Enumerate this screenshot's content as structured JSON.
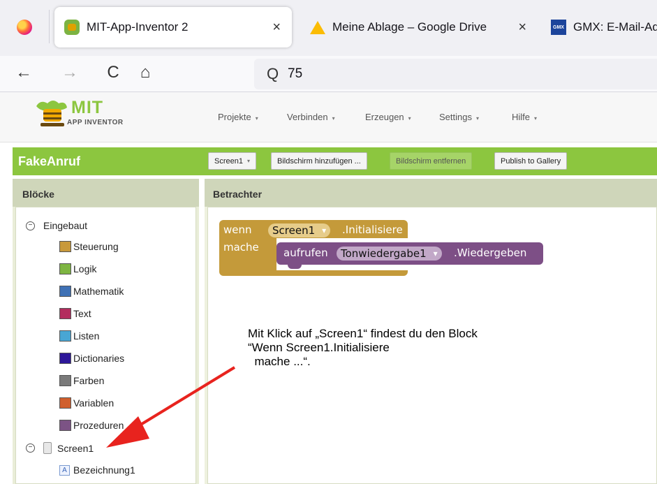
{
  "browser": {
    "tabs": [
      {
        "title": "MIT-App-Inventor 2",
        "icon": "mit-app-inventor-favicon",
        "active": true,
        "close": "×"
      },
      {
        "title": "Meine Ablage – Google Drive",
        "icon": "google-drive-favicon",
        "active": false,
        "close": "×"
      },
      {
        "title": "GMX: E-Mail-Ad",
        "icon": "gmx-favicon",
        "active": false,
        "badge": "GMX"
      }
    ],
    "nav": {
      "back": "←",
      "forward": "→",
      "reload": "C",
      "home": "⌂"
    },
    "url": "75",
    "search_icon": "Q"
  },
  "header": {
    "logo_text": "MIT",
    "logo_subtext": "APP INVENTOR",
    "menu": [
      "Projekte",
      "Verbinden",
      "Erzeugen",
      "Settings",
      "Hilfe"
    ],
    "menu_caret": "▾"
  },
  "toolbar": {
    "project_name": "FakeAnruf",
    "screen_select": "Screen1",
    "add_screen": "Bildschirm hinzufügen ...",
    "remove_screen": "Bildschirm entfernen",
    "publish": "Publish to Gallery"
  },
  "blocks_panel": {
    "title": "Blöcke",
    "builtin_label": "Eingebaut",
    "items": [
      {
        "label": "Steuerung",
        "color": "#c8993b"
      },
      {
        "label": "Logik",
        "color": "#7eb542"
      },
      {
        "label": "Mathematik",
        "color": "#3f71b5"
      },
      {
        "label": "Text",
        "color": "#b32d5e"
      },
      {
        "label": "Listen",
        "color": "#49a6d4"
      },
      {
        "label": "Dictionaries",
        "color": "#2d1799"
      },
      {
        "label": "Farben",
        "color": "#7a7a7a"
      },
      {
        "label": "Variablen",
        "color": "#d05f2d"
      },
      {
        "label": "Prozeduren",
        "color": "#7c5385"
      }
    ],
    "screen_label": "Screen1",
    "component_label": "Bezeichnung1",
    "component_icon_letter": "A"
  },
  "viewer": {
    "title": "Betrachter",
    "event_block": {
      "when": "wenn",
      "component": "Screen1",
      "event": ".Initialisiere",
      "do": "mache"
    },
    "call_block": {
      "call": "aufrufen",
      "component": "Tonwiedergabe1",
      "method": ".Wiedergeben"
    }
  },
  "annotation": {
    "lines": [
      "Mit Klick auf „Screen1“ findest du den Block",
      "“Wenn Screen1.Initialisiere",
      "  mache ...“."
    ],
    "arrow_color": "#e8231e"
  },
  "colors": {
    "green_bar": "#8cc63f",
    "event_block": "#c49a3a",
    "call_block": "#7d4f86"
  }
}
